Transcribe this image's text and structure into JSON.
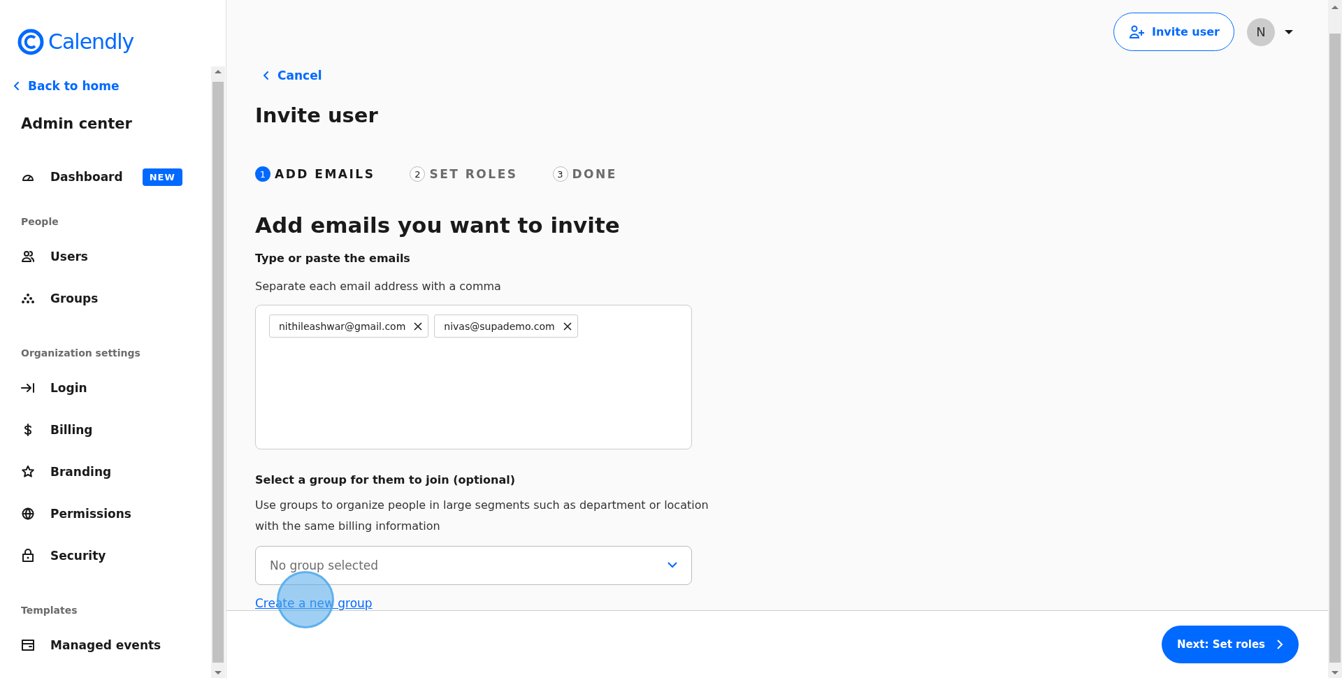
{
  "sidebar": {
    "logo": "Calendly",
    "back_link": "Back to home",
    "title": "Admin center",
    "entries": [
      {
        "kind": "item",
        "label": "Dashboard",
        "badge": "NEW"
      },
      {
        "kind": "section",
        "label": "People"
      },
      {
        "kind": "item",
        "label": "Users"
      },
      {
        "kind": "item",
        "label": "Groups"
      },
      {
        "kind": "section",
        "label": "Organization settings"
      },
      {
        "kind": "item",
        "label": "Login"
      },
      {
        "kind": "item",
        "label": "Billing"
      },
      {
        "kind": "item",
        "label": "Branding"
      },
      {
        "kind": "item",
        "label": "Permissions"
      },
      {
        "kind": "item",
        "label": "Security"
      },
      {
        "kind": "section",
        "label": "Templates"
      },
      {
        "kind": "item",
        "label": "Managed events"
      }
    ]
  },
  "header": {
    "invite_button": "Invite user",
    "avatar": "N"
  },
  "cancel_link": "Cancel",
  "page_title": "Invite user",
  "steps": [
    {
      "number": "1",
      "label": "ADD EMAILS",
      "selected": true
    },
    {
      "number": "2",
      "label": "SET ROLES",
      "selected": false
    },
    {
      "number": "3",
      "label": "DONE",
      "selected": false
    }
  ],
  "section_title": "Add emails you want to invite",
  "emails": {
    "label": "Type or paste the emails",
    "hint": "Separate each email address with a comma",
    "chips": [
      "nithileashwar@gmail.com",
      "nivas@supademo.com"
    ]
  },
  "group": {
    "label": "Select a group for them to join (optional)",
    "hint": "Use groups to organize people in large segments such as department or location with the same billing information",
    "placeholder": "No group selected",
    "create_link": "Create a new group"
  },
  "footer": {
    "next_button": "Next: Set roles"
  }
}
